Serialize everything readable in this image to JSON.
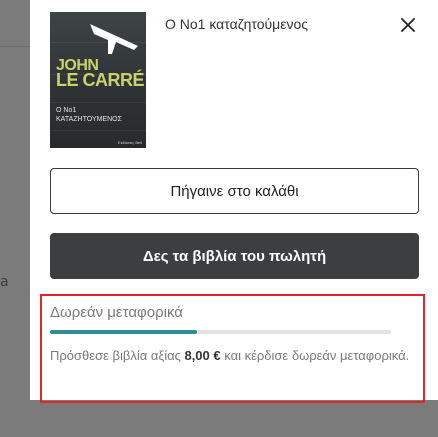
{
  "product": {
    "title": "Ο Νο1 καταζητούμενος",
    "cover": {
      "author_line1": "JOHN",
      "author_line2": "LE CARRÉ",
      "title_line1": "Ο Νο1",
      "title_line2": "ΚΑΤΑΖΗΤΟΥΜΕΝΟΣ",
      "publisher": "Εκδόσεις Bell"
    }
  },
  "actions": {
    "go_to_cart": "Πήγαινε στο καλάθι",
    "seller_books": "Δες τα βιβλία του πωλητή"
  },
  "shipping": {
    "title": "Δωρεάν μεταφορικά",
    "progress_fraction": 0.43,
    "text_before": "Πρόσθεσε βιβλία αξίας ",
    "amount": "8,00 €",
    "text_after": " και κέρδισε δωρεάν μεταφορικά."
  },
  "colors": {
    "accent": "#2d8f91",
    "highlight_border": "#e0252b",
    "dark_button": "#3c3e40"
  },
  "icons": {
    "close": "close-icon",
    "cover_plane": "airplane-icon"
  },
  "background_page": {
    "partial_letter": "a"
  }
}
